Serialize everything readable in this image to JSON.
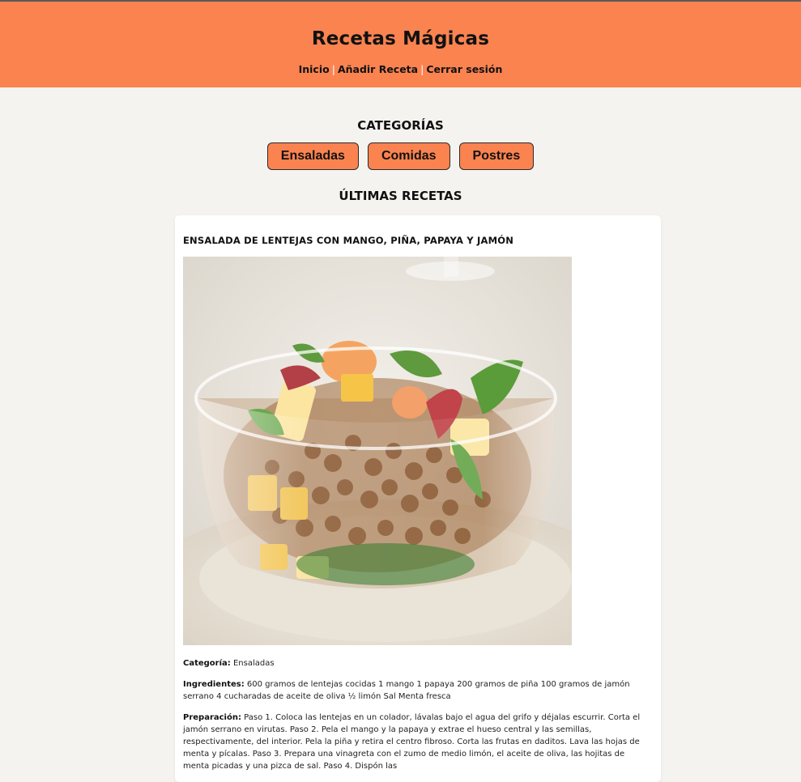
{
  "header": {
    "title": "Recetas Mágicas",
    "nav": [
      {
        "label": "Inicio"
      },
      {
        "label": "Añadir Receta"
      },
      {
        "label": "Cerrar sesión"
      }
    ],
    "separator": "|"
  },
  "categories": {
    "title": "CATEGORÍAS",
    "buttons": [
      {
        "label": "Ensaladas"
      },
      {
        "label": "Comidas"
      },
      {
        "label": "Postres"
      }
    ]
  },
  "latest": {
    "title": "ÚLTIMAS RECETAS",
    "recipe": {
      "title": "ENSALADA DE LENTEJAS CON MANGO, PIÑA, PAPAYA Y JAMÓN",
      "category_label": "Categoría:",
      "category": "Ensaladas",
      "ingredients_label": "Ingredientes:",
      "ingredients": "600 gramos de lentejas cocidas 1 mango 1 papaya 200 gramos de piña 100 gramos de jamón serrano 4 cucharadas de aceite de oliva ½ limón Sal Menta fresca",
      "preparation_label": "Preparación:",
      "preparation": "Paso 1. Coloca las lentejas en un colador, lávalas bajo el agua del grifo y déjalas escurrir. Corta el jamón serrano en virutas. Paso 2. Pela el mango y la papaya y extrae el hueso central y las semillas, respectivamente, del interior. Pela la piña y retira el centro fibroso. Corta las frutas en daditos. Lava las hojas de menta y pícalas. Paso 3. Prepara una vinagreta con el zumo de medio limón, el aceite de oliva, las hojitas de menta picadas y una pizca de sal. Paso 4. Dispón las"
    }
  },
  "colors": {
    "accent": "#fa8350",
    "background": "#f4f3ef",
    "card": "#ffffff"
  }
}
